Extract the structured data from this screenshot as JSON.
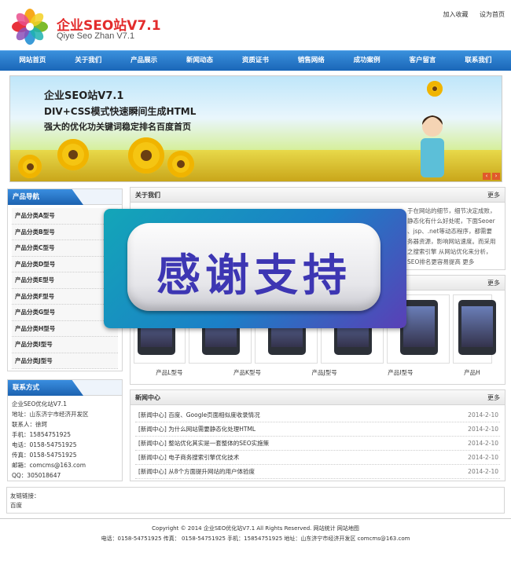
{
  "header": {
    "site_name": "企业SEO站V7.1",
    "site_sub": "Qiye Seo Zhan V7.1",
    "links": [
      "加入收藏",
      "设为首页"
    ]
  },
  "nav": [
    "网站首页",
    "关于我们",
    "产品展示",
    "新闻动态",
    "资质证书",
    "销售网络",
    "成功案例",
    "客户留言",
    "联系我们"
  ],
  "banner": {
    "line1": "企业SEO站V7.1",
    "line2": "DIV+CSS模式快速瞬间生成HTML",
    "line3": "强大的优化功关键词稳定排名百度首页"
  },
  "sidebar": {
    "cat_title": "产品导航",
    "categories": [
      "产品分类A型号",
      "产品分类B型号",
      "产品分类C型号",
      "产品分类D型号",
      "产品分类E型号",
      "产品分类F型号",
      "产品分类G型号",
      "产品分类H型号",
      "产品分类I型号",
      "产品分类J型号"
    ],
    "contact_title": "联系方式",
    "contact": [
      "企业SEO优化站V7.1",
      "地址：山东济宁市经济开发区",
      "联系人：徐珂",
      "手机：15854751925",
      "电话：0158-54751925",
      "传真：0158-54751925",
      "邮箱：comcms@163.com",
      "QQ：305018647"
    ]
  },
  "about": {
    "title": "关于我们",
    "more": "更多",
    "text": [
      "于在网站的细节，细节决定成败，",
      "静态化有什么好处呢，下面Seoer",
      "、jsp、.net等动态程序，都需要",
      "务器资源，影响网站速度。而采用",
      "之搜索引擎 从网站优化来分析，",
      "SEO排名更容易提高"
    ],
    "text_more": "更多"
  },
  "products": {
    "more": "更多",
    "names": [
      "产品L型号",
      "产品K型号",
      "产品J型号",
      "产品I型号",
      "产品H"
    ]
  },
  "news": {
    "title": "新闻中心",
    "more": "更多",
    "items": [
      {
        "title": "[新闻中心] 百度、Google页面相似度收录情况",
        "date": "2014-2-10"
      },
      {
        "title": "[新闻中心] 为什么网站需要静态化处理HTML",
        "date": "2014-2-10"
      },
      {
        "title": "[新闻中心] 整站优化其实是一套整体的SEO实施策",
        "date": "2014-2-10"
      },
      {
        "title": "[新闻中心] 电子商务搜索引擎优化技术",
        "date": "2014-2-10"
      },
      {
        "title": "[新闻中心] 从8个方面提升网站的用户体验度",
        "date": "2014-2-10"
      }
    ]
  },
  "links": {
    "label": "友链链接：",
    "item": "百度"
  },
  "footer": {
    "line1": "Copyright © 2014 企业SEO优化站V7.1 All Rights Reserved. 网站统计  网站地图",
    "line2": "电话：0158-54751925  传真： 0158-54751925 手机：15854751925  地址：山东济宁市经济开发区  comcms@163.com"
  },
  "overlay": {
    "text": "感谢支持"
  }
}
